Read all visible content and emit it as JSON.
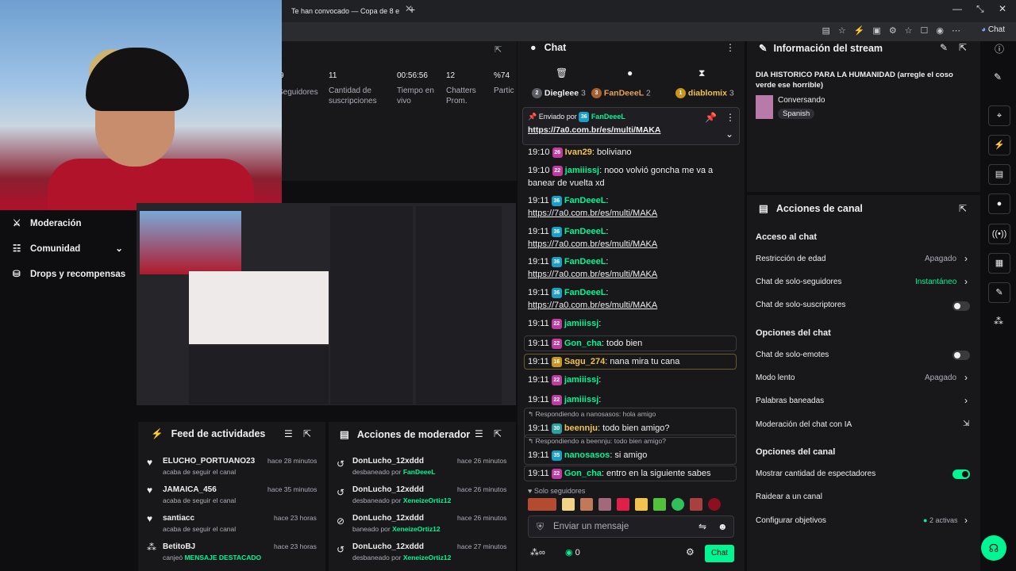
{
  "browser": {
    "tab_title": "Te han convocado — Copa de 8 e",
    "chat_button": "Chat"
  },
  "stats": {
    "items": [
      {
        "value": "9",
        "label": "Seguidores"
      },
      {
        "value": "11",
        "label": "Cantidad de suscripciones"
      },
      {
        "value": "00:56:56",
        "label": "Tiempo en vivo"
      },
      {
        "value": "12",
        "label": "Chatters Prom."
      },
      {
        "value": "%74",
        "label": "Partic"
      }
    ]
  },
  "nav": {
    "items": [
      {
        "label": "Moderación"
      },
      {
        "label": "Comunidad"
      },
      {
        "label": "Drops y recompensas"
      }
    ]
  },
  "feed": {
    "title": "Feed de actividades",
    "items": [
      {
        "name": "ELUCHO_PORTUANO23",
        "sub": "acaba de seguir el canal",
        "time": "hace 28 minutos"
      },
      {
        "name": "JAMAICA_456",
        "sub": "acaba de seguir el canal",
        "time": "hace 35 minutos"
      },
      {
        "name": "santiacc",
        "sub": "acaba de seguir el canal",
        "time": "hace 23 horas"
      },
      {
        "name": "BetitoBJ",
        "sub": "canjeó",
        "sub_hl": "MENSAJE DESTACADO",
        "time": "hace 23 horas"
      }
    ]
  },
  "mod": {
    "title": "Acciones de moderador",
    "items": [
      {
        "name": "DonLucho_12xddd",
        "sub": "desbaneado por",
        "by": "FanDeeeL",
        "time": "hace 26 minutos"
      },
      {
        "name": "DonLucho_12xddd",
        "sub": "desbaneado por",
        "by": "XeneizeOrtiz12",
        "time": "hace 26 minutos"
      },
      {
        "name": "DonLucho_12xddd",
        "sub": "baneado por",
        "by": "XeneizeOrtiz12",
        "time": "hace 26 minutos"
      },
      {
        "name": "DonLucho_12xddd",
        "sub": "desbaneado por",
        "by": "XeneizeOrtiz12",
        "time": "hace 27 minutos"
      }
    ]
  },
  "chat": {
    "title": "Chat",
    "leaderboard": [
      {
        "rank": "2",
        "name": "Diegleee",
        "count": "3"
      },
      {
        "rank": "3",
        "name": "FanDeeeL",
        "count": "2"
      },
      {
        "rank": "1",
        "name": "diablomix",
        "count": "3"
      }
    ],
    "pinned": {
      "by_label": "Enviado por",
      "by": "FanDeeeL",
      "link": "https://7a0.com.br/es/multi/MAKA"
    },
    "messages": [
      {
        "time": "19:10",
        "badge": "26",
        "user": "Ivan29",
        "text": ": boliviano"
      },
      {
        "time": "19:10",
        "badge": "22",
        "user": "jamiiissj",
        "text": ": nooo volvió goncha me va a banear de vuelta xd"
      },
      {
        "time": "19:11",
        "badge": "36",
        "user": "FanDeeeL",
        "text": ":",
        "link": "https://7a0.com.br/es/multi/MAKA"
      },
      {
        "time": "19:11",
        "badge": "36",
        "user": "FanDeeeL",
        "text": ":",
        "link": "https://7a0.com.br/es/multi/MAKA"
      },
      {
        "time": "19:11",
        "badge": "36",
        "user": "FanDeeeL",
        "text": ":",
        "link": "https://7a0.com.br/es/multi/MAKA"
      },
      {
        "time": "19:11",
        "badge": "36",
        "user": "FanDeeeL",
        "text": ":",
        "link": "https://7a0.com.br/es/multi/MAKA"
      },
      {
        "time": "19:11",
        "badge": "22",
        "user": "jamiiissj",
        "text": ":"
      },
      {
        "time": "19:11",
        "badge": "22",
        "user": "Gon_cha",
        "text": ": todo bien"
      },
      {
        "time": "19:11",
        "badge": "16",
        "user": "Sagu_274",
        "text": ": nana mira tu cana"
      },
      {
        "time": "19:11",
        "badge": "22",
        "user": "jamiiissj",
        "text": ":"
      },
      {
        "time": "19:11",
        "badge": "22",
        "user": "jamiiissj",
        "text": ":"
      },
      {
        "reply": "Respondiendo a nanosasos: hola amigo",
        "time": "19:11",
        "badge": "30",
        "user": "beennju",
        "text": ": todo bien amigo?"
      },
      {
        "reply": "Respondiendo a beennju: todo bien amigo?",
        "time": "19:11",
        "badge": "35",
        "user": "nanosasos",
        "text": ": si amigo"
      },
      {
        "time": "19:11",
        "badge": "22",
        "user": "Gon_cha",
        "text": ": entro en la siguiente sabes"
      }
    ],
    "followers_only": "Solo seguidores",
    "input_placeholder": "Enviar un mensaje",
    "points": "0",
    "send_label": "Chat"
  },
  "info": {
    "title": "Información del stream",
    "stream_title": "DIA HISTORICO PARA LA HUMANIDAD (arregle el coso verde ese horrible)",
    "category": "Conversando",
    "tag": "Spanish"
  },
  "actions": {
    "title": "Acciones de canal",
    "sections": [
      {
        "header": "Acceso al chat"
      },
      {
        "header": "Opciones del chat"
      },
      {
        "header": "Opciones del canal"
      }
    ],
    "rows": {
      "age": {
        "label": "Restricción de edad",
        "value": "Apagado"
      },
      "followers": {
        "label": "Chat de solo-seguidores",
        "value": "Instantáneo"
      },
      "subs": {
        "label": "Chat de solo-suscriptores"
      },
      "emotes": {
        "label": "Chat de solo-emotes"
      },
      "slow": {
        "label": "Modo lento",
        "value": "Apagado"
      },
      "banned": {
        "label": "Palabras baneadas"
      },
      "ai": {
        "label": "Moderación del chat con IA"
      },
      "viewers": {
        "label": "Mostrar cantidad de espectadores"
      },
      "raid": {
        "label": "Raidear a un canal"
      },
      "goals": {
        "label": "Configurar objetivos",
        "value": "2 activas"
      }
    }
  },
  "colors": {
    "accent": "#00f593",
    "link": "#efeff1",
    "purple": "#a970ff"
  }
}
